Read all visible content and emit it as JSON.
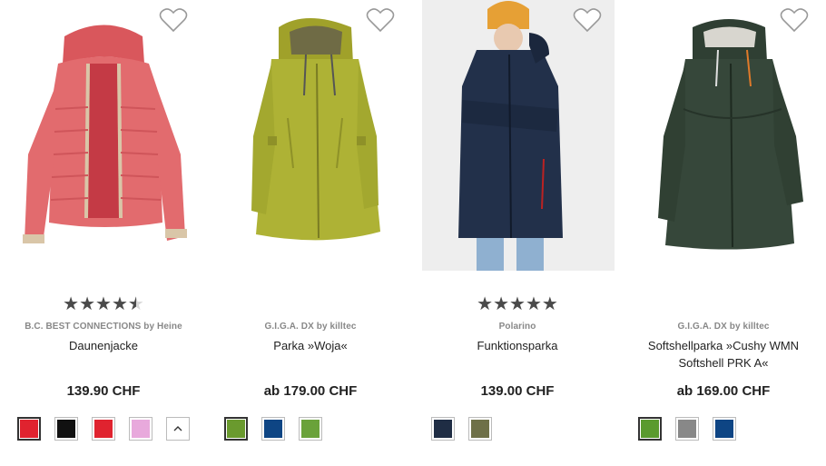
{
  "products": [
    {
      "brand": "B.C. BEST CONNECTIONS by Heine",
      "title_line1": "Daunenjacke",
      "title_line2": "",
      "price": "139.90 CHF",
      "rating": 4.5,
      "image_icon": "pink-down-jacket",
      "swatches": [
        {
          "color": "#e0232f",
          "selected": true
        },
        {
          "color": "#111111",
          "selected": false
        },
        {
          "color": "#e0232f",
          "selected": false
        },
        {
          "color": "#e8a9dc",
          "selected": false
        }
      ],
      "more_label": "^"
    },
    {
      "brand": "G.I.G.A. DX by killtec",
      "title_line1": "Parka »Woja«",
      "title_line2": "",
      "price": "ab 179.00 CHF",
      "rating": null,
      "image_icon": "lime-parka",
      "swatches": [
        {
          "color": "#6a9a2e",
          "selected": true
        },
        {
          "color": "#0e4584",
          "selected": false
        },
        {
          "color": "#6aa23a",
          "selected": false
        }
      ]
    },
    {
      "brand": "Polarino",
      "title_line1": "Funktionsparka",
      "title_line2": "",
      "price": "139.00 CHF",
      "rating": 5,
      "image_icon": "navy-parka-model",
      "swatches": [
        {
          "color": "#1f2d44",
          "selected": false
        },
        {
          "color": "#6e7048",
          "selected": false
        }
      ]
    },
    {
      "brand": "G.I.G.A. DX by killtec",
      "title_line1": "Softshellparka »Cushy WMN",
      "title_line2": "Softshell PRK A«",
      "price": "ab 169.00 CHF",
      "rating": null,
      "image_icon": "dark-green-softshell-parka",
      "swatches": [
        {
          "color": "#5a9a2e",
          "selected": true
        },
        {
          "color": "#888888",
          "selected": false
        },
        {
          "color": "#0e4584",
          "selected": false
        }
      ]
    }
  ],
  "colors": {
    "star_fill": "#4a4a4a",
    "star_empty": "#d8d8d8",
    "brand_text": "#888888"
  }
}
